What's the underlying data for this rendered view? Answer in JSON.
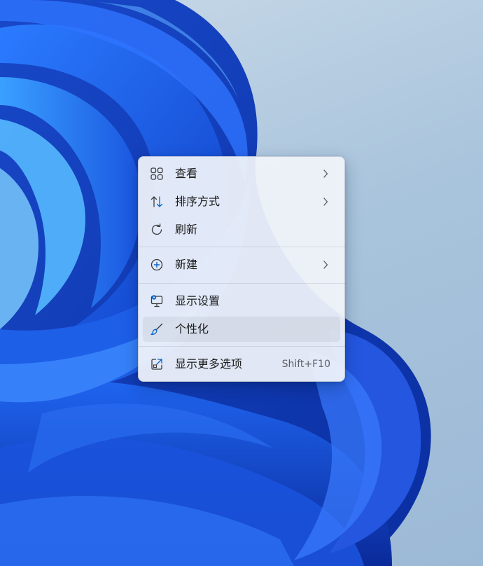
{
  "desktop": {
    "wallpaper": "Windows 11 Bloom (blue)",
    "background_color": "#a9c4dc",
    "bloom_color": "#1a4fd6"
  },
  "context_menu": {
    "items": [
      {
        "label": "查看",
        "icon": "grid-view-icon",
        "has_submenu": true
      },
      {
        "label": "排序方式",
        "icon": "sort-arrows-icon",
        "has_submenu": true
      },
      {
        "label": "刷新",
        "icon": "refresh-icon",
        "has_submenu": false
      },
      {
        "label": "新建",
        "icon": "plus-circle-icon",
        "has_submenu": true
      },
      {
        "label": "显示设置",
        "icon": "display-settings-icon",
        "has_submenu": false
      },
      {
        "label": "个性化",
        "icon": "brush-icon",
        "has_submenu": false,
        "highlighted": true
      },
      {
        "label": "显示更多选项",
        "icon": "open-external-icon",
        "has_submenu": false,
        "shortcut": "Shift+F10"
      }
    ],
    "accent_color": "#0a66c8"
  }
}
